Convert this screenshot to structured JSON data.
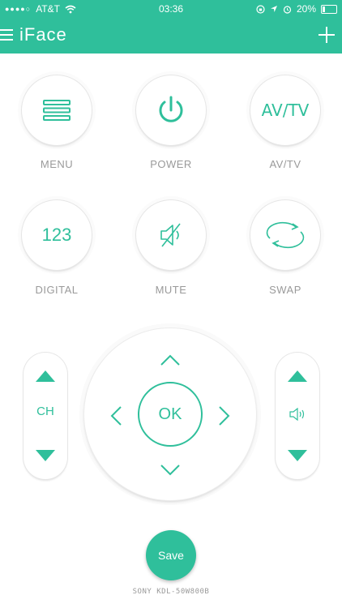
{
  "status_bar": {
    "carrier": "AT&T",
    "time": "03:36",
    "battery": "20%",
    "battery_level": 0.2
  },
  "header": {
    "title": "iFace",
    "menu_icon": "hamburger-menu-icon",
    "add_icon": "plus-icon"
  },
  "colors": {
    "accent": "#2fbf9b",
    "caption": "#9a9a9a"
  },
  "buttons": {
    "menu": "MENU",
    "power": "POWER",
    "avtv": "AV/TV",
    "avtv_icon_text": "AV/TV",
    "digital": "DIGITAL",
    "digital_icon_text": "123",
    "mute": "MUTE",
    "swap": "SWAP"
  },
  "channel": {
    "label": "CH"
  },
  "dpad": {
    "ok": "OK"
  },
  "actions": {
    "save": "Save"
  },
  "device": "SONY KDL-50W800B"
}
